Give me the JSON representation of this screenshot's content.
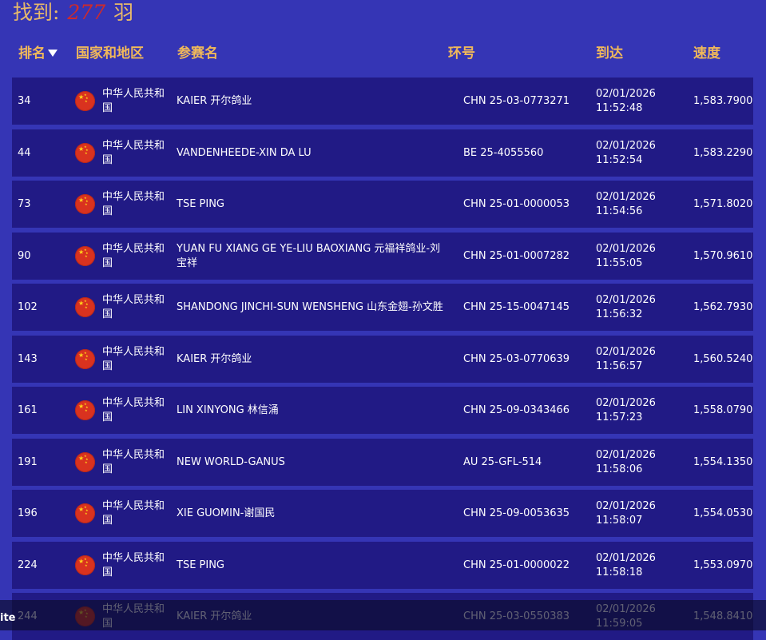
{
  "summary": {
    "prefix": "找到:",
    "count": "277",
    "suffix": "羽"
  },
  "columns": {
    "rank": "排名",
    "country": "国家和地区",
    "name": "参赛名",
    "ring": "环号",
    "arrival": "到达",
    "speed": "速度"
  },
  "rows": [
    {
      "rank": "34",
      "country": "中华人民共和国",
      "name": "KAIER 开尔鸽业",
      "ring": "CHN 25-03-0773271",
      "date": "02/01/2026",
      "time": "11:52:48",
      "speed": "1,583.7900"
    },
    {
      "rank": "44",
      "country": "中华人民共和国",
      "name": "VANDENHEEDE-XIN DA LU",
      "ring": "BE 25-4055560",
      "date": "02/01/2026",
      "time": "11:52:54",
      "speed": "1,583.2290"
    },
    {
      "rank": "73",
      "country": "中华人民共和国",
      "name": "TSE PING",
      "ring": "CHN 25-01-0000053",
      "date": "02/01/2026",
      "time": "11:54:56",
      "speed": "1,571.8020"
    },
    {
      "rank": "90",
      "country": "中华人民共和国",
      "name": "YUAN FU XIANG GE YE-LIU BAOXIANG 元福祥鸽业-刘宝祥",
      "ring": "CHN 25-01-0007282",
      "date": "02/01/2026",
      "time": "11:55:05",
      "speed": "1,570.9610"
    },
    {
      "rank": "102",
      "country": "中华人民共和国",
      "name": "SHANDONG JINCHI-SUN WENSHENG 山东金翅-孙文胜",
      "ring": "CHN 25-15-0047145",
      "date": "02/01/2026",
      "time": "11:56:32",
      "speed": "1,562.7930"
    },
    {
      "rank": "143",
      "country": "中华人民共和国",
      "name": "KAIER 开尔鸽业",
      "ring": "CHN 25-03-0770639",
      "date": "02/01/2026",
      "time": "11:56:57",
      "speed": "1,560.5240"
    },
    {
      "rank": "161",
      "country": "中华人民共和国",
      "name": "LIN XINYONG 林信涌",
      "ring": "CHN 25-09-0343466",
      "date": "02/01/2026",
      "time": "11:57:23",
      "speed": "1,558.0790"
    },
    {
      "rank": "191",
      "country": "中华人民共和国",
      "name": "NEW WORLD-GANUS",
      "ring": "AU 25-GFL-514",
      "date": "02/01/2026",
      "time": "11:58:06",
      "speed": "1,554.1350"
    },
    {
      "rank": "196",
      "country": "中华人民共和国",
      "name": "XIE GUOMIN-谢国民",
      "ring": "CHN 25-09-0053635",
      "date": "02/01/2026",
      "time": "11:58:07",
      "speed": "1,554.0530"
    },
    {
      "rank": "224",
      "country": "中华人民共和国",
      "name": "TSE PING",
      "ring": "CHN 25-01-0000022",
      "date": "02/01/2026",
      "time": "11:58:18",
      "speed": "1,553.0970"
    },
    {
      "rank": "244",
      "country": "中华人民共和国",
      "name": "KAIER 开尔鸽业",
      "ring": "CHN 25-03-0550383",
      "date": "02/01/2026",
      "time": "11:59:05",
      "speed": "1,548.8410"
    }
  ],
  "bottom_bar": {
    "label": "ite"
  },
  "colors": {
    "background": "#3535b5",
    "row": "#211a85",
    "header_text": "#f0b85a",
    "count": "#d02a2a"
  },
  "icons": {
    "flag": "china-flag-icon",
    "sort": "sort-desc-arrow-icon"
  }
}
